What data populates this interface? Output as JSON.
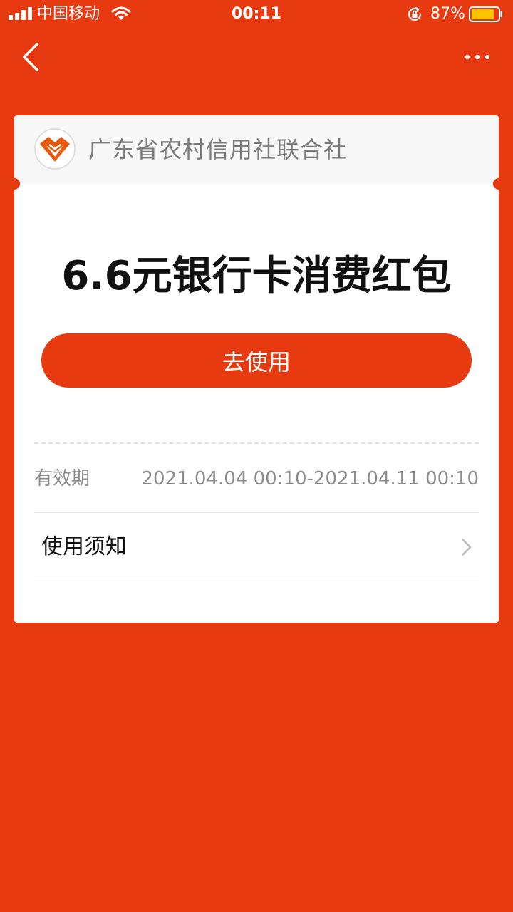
{
  "status_bar": {
    "carrier": "中国移动",
    "time": "00:11",
    "battery_percent": "87%",
    "battery_level": 0.87
  },
  "nav": {
    "back_icon": "chevron-left-icon",
    "more_icon": "more-dots-icon"
  },
  "card": {
    "bank_name": "广东省农村信用社联合社",
    "title": "6.6元银行卡消费红包",
    "button_label": "去使用",
    "validity_label": "有效期",
    "validity_value": "2021.04.04 00:10-2021.04.11 00:10",
    "notice_label": "使用须知"
  },
  "colors": {
    "brand_red": "#E83A10",
    "logo_orange": "#E8590C",
    "battery_yellow": "#FFC400"
  }
}
